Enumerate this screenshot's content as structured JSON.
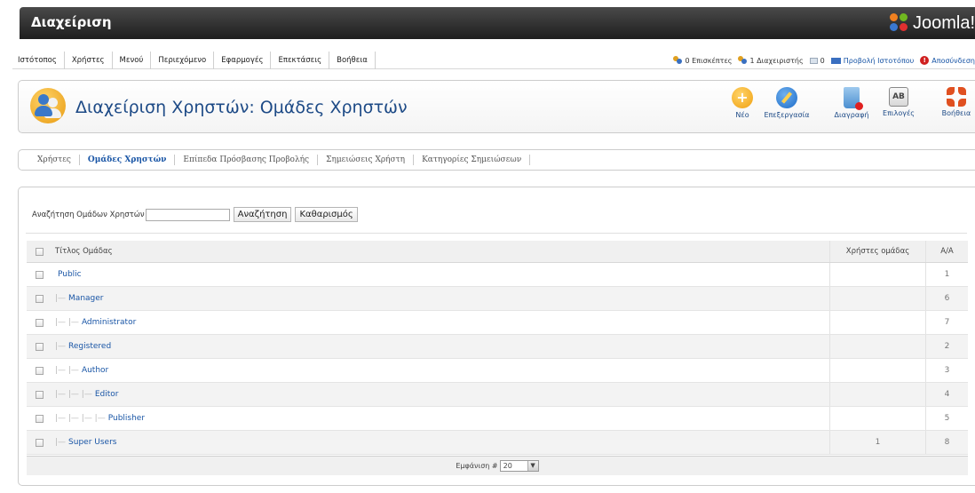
{
  "header": {
    "title": "Διαχείριση",
    "logo_text": "Joomla!"
  },
  "menu": {
    "items": [
      "Ιστότοπος",
      "Χρήστες",
      "Μενού",
      "Περιεχόμενο",
      "Εφαρμογές",
      "Επεκτάσεις",
      "Βοήθεια"
    ],
    "status": {
      "visitors": "0 Επισκέπτες",
      "admins": "1 Διαχειριστής",
      "messages": "0",
      "view_site": "Προβολή Ιστοτόπου",
      "logout": "Αποσύνδεση"
    }
  },
  "toolbar": {
    "page_title": "Διαχείριση Χρηστών: Ομάδες Χρηστών",
    "new": "Νέο",
    "edit": "Επεξεργασία",
    "delete": "Διαγραφή",
    "options": "Επιλογές",
    "help": "Βοήθεια"
  },
  "tabs": [
    "Χρήστες",
    "Ομάδες Χρηστών",
    "Επίπεδα Πρόσβασης Προβολής",
    "Σημειώσεις Χρήστη",
    "Κατηγορίες Σημειώσεων"
  ],
  "active_tab": "Ομάδες Χρηστών",
  "filter": {
    "label": "Αναζήτηση Ομάδων Χρηστών",
    "value": "",
    "search_button": "Αναζήτηση",
    "clear_button": "Καθαρισμός"
  },
  "table": {
    "columns": {
      "title": "Τίτλος Ομάδας",
      "users": "Χρήστες ομάδας",
      "id": "Α/Α"
    },
    "rows": [
      {
        "indent": "",
        "title": "Public",
        "users": "",
        "id": "1"
      },
      {
        "indent": "|—",
        "title": "Manager",
        "users": "",
        "id": "6"
      },
      {
        "indent": "|— |—",
        "title": "Administrator",
        "users": "",
        "id": "7"
      },
      {
        "indent": "|—",
        "title": "Registered",
        "users": "",
        "id": "2"
      },
      {
        "indent": "|— |—",
        "title": "Author",
        "users": "",
        "id": "3"
      },
      {
        "indent": "|— |— |—",
        "title": "Editor",
        "users": "",
        "id": "4"
      },
      {
        "indent": "|— |— |— |—",
        "title": "Publisher",
        "users": "",
        "id": "5"
      },
      {
        "indent": "|—",
        "title": "Super Users",
        "users": "1",
        "id": "8"
      }
    ]
  },
  "pager": {
    "label": "Εμφάνιση #",
    "value": "20"
  },
  "colors": {
    "header_bg": "#2b2b2b",
    "link": "#1a56a6",
    "title": "#1d4a86"
  }
}
